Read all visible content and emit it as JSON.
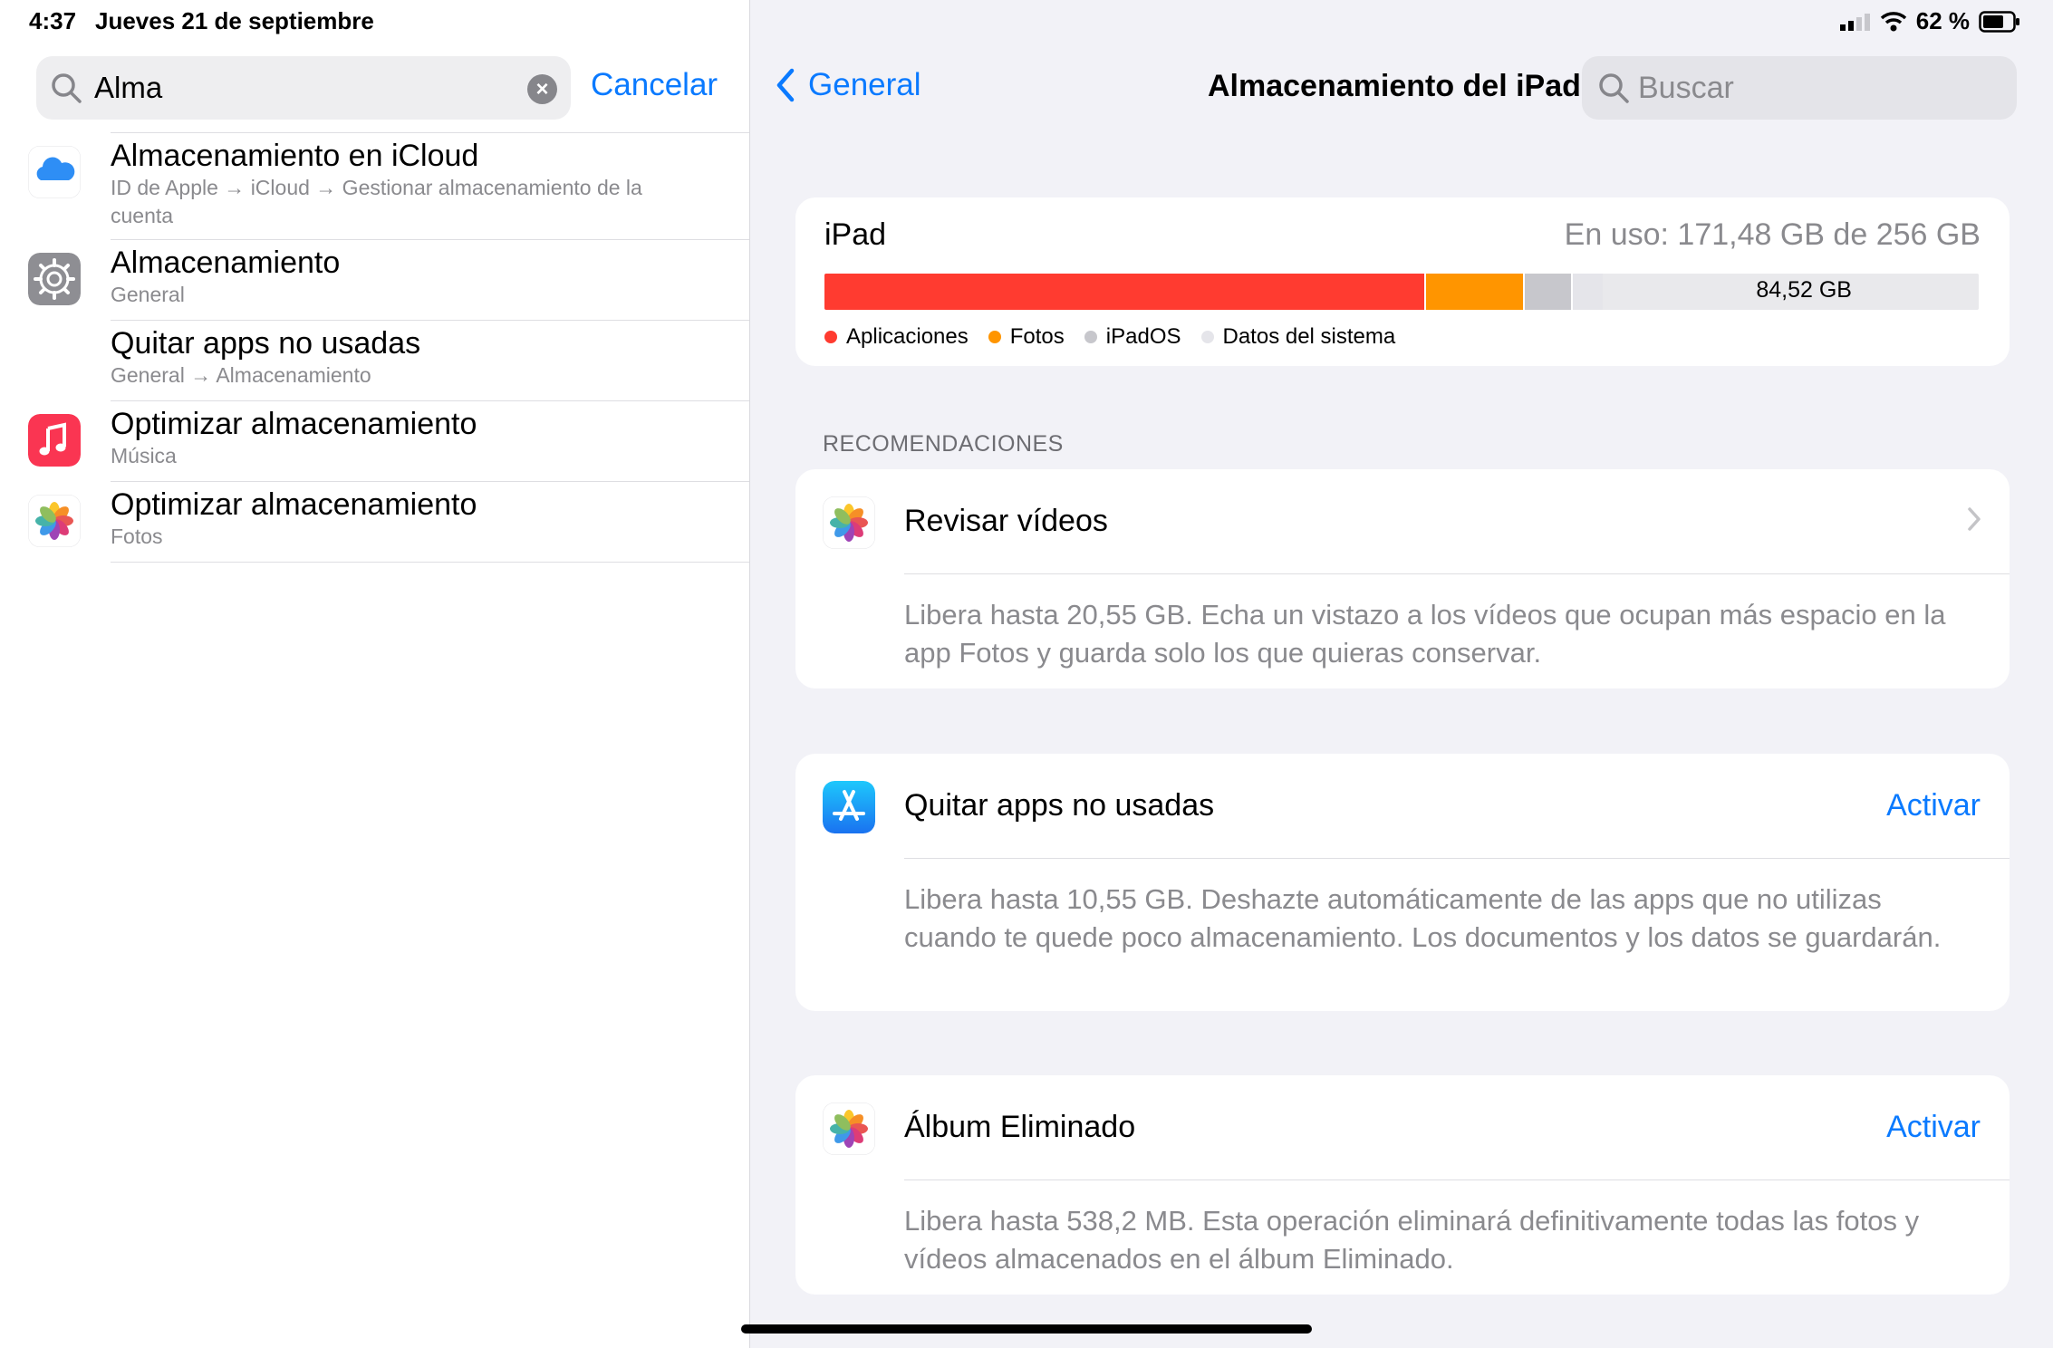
{
  "status": {
    "time": "4:37",
    "date": "Jueves 21 de septiembre",
    "battery": "62 %"
  },
  "sidebar": {
    "search_value": "Alma",
    "cancel_label": "Cancelar",
    "results": [
      {
        "title": "Almacenamiento en iCloud",
        "subtitle": "ID de Apple → iCloud → Gestionar almacenamiento de la cuenta",
        "icon": "icloud-icon"
      },
      {
        "title": "Almacenamiento",
        "subtitle": "General",
        "icon": "settings-gear-icon"
      },
      {
        "title": "Quitar apps no usadas",
        "subtitle": "General → Almacenamiento",
        "icon": ""
      },
      {
        "title": "Optimizar almacenamiento",
        "subtitle": "Música",
        "icon": "music-icon"
      },
      {
        "title": "Optimizar almacenamiento",
        "subtitle": "Fotos",
        "icon": "photos-icon"
      }
    ]
  },
  "header": {
    "back_label": "General",
    "title": "Almacenamiento del iPad",
    "search_placeholder": "Buscar"
  },
  "storage": {
    "device": "iPad",
    "used_text": "En uso: 171,48 GB de 256 GB",
    "free_text": "84,52 GB",
    "segments": [
      {
        "name": "Aplicaciones",
        "gb": 133.0,
        "color": "#ff3b30"
      },
      {
        "name": "Fotos",
        "gb": 21.5,
        "color": "#ff9500"
      },
      {
        "name": "iPadOS",
        "gb": 10.3,
        "color": "#c7c7cc"
      },
      {
        "name": "Datos del sistema",
        "gb": 6.68,
        "color": "#e5e5ea"
      }
    ],
    "total_gb": 256,
    "legend": [
      "Aplicaciones",
      "Fotos",
      "iPadOS",
      "Datos del sistema"
    ]
  },
  "recommendations": {
    "header": "RECOMENDACIONES",
    "items": [
      {
        "title": "Revisar vídeos",
        "action": "",
        "desc": "Libera hasta 20,55 GB. Echa un vistazo a los vídeos que ocupan más espacio en la app Fotos y guarda solo los que quieras conservar.",
        "icon": "photos-icon"
      },
      {
        "title": "Quitar apps no usadas",
        "action": "Activar",
        "desc": "Libera hasta 10,55 GB. Deshazte automáticamente de las apps que no utilizas cuando te quede poco almacenamiento. Los documentos y los datos se guardarán.",
        "icon": "app-store-icon"
      },
      {
        "title": "Álbum Eliminado",
        "action": "Activar",
        "desc": "Libera hasta 538,2 MB. Esta operación eliminará definitivamente todas las fotos y vídeos almacenados en el álbum Eliminado.",
        "icon": "photos-icon"
      }
    ]
  }
}
